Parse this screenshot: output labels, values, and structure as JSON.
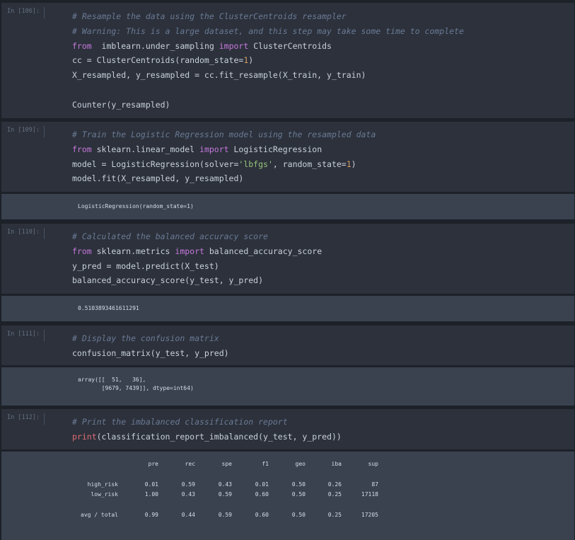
{
  "cells": [
    {
      "prompt": "In [106]:",
      "lines": [
        [
          [
            "cm",
            "# Resample the data using the ClusterCentroids resampler"
          ]
        ],
        [
          [
            "cm",
            "# Warning: This is a large dataset, and this step may take some time to complete"
          ]
        ],
        [
          [
            "kw",
            "from"
          ],
          [
            "",
            "  imblearn.under_sampling "
          ],
          [
            "kw",
            "import"
          ],
          [
            "",
            " ClusterCentroids"
          ]
        ],
        [
          [
            "",
            "cc = ClusterCentroids(random_state="
          ],
          [
            "num",
            "1"
          ],
          [
            "",
            ")"
          ]
        ],
        [
          [
            "",
            "X_resampled, y_resampled = cc.fit_resample(X_train, y_train)"
          ]
        ],
        [
          [
            "",
            ""
          ]
        ],
        [
          [
            "",
            "Counter(y_resampled)"
          ]
        ]
      ]
    },
    {
      "prompt": "In [109]:",
      "lines": [
        [
          [
            "cm",
            "# Train the Logistic Regression model using the resampled data"
          ]
        ],
        [
          [
            "kw",
            "from"
          ],
          [
            "",
            " sklearn.linear_model "
          ],
          [
            "kw",
            "import"
          ],
          [
            "",
            " LogisticRegression"
          ]
        ],
        [
          [
            "",
            "model = LogisticRegression(solver="
          ],
          [
            "str",
            "'lbfgs'"
          ],
          [
            "",
            ", random_state="
          ],
          [
            "num",
            "1"
          ],
          [
            "",
            ")"
          ]
        ],
        [
          [
            "",
            "model.fit(X_resampled, y_resampled)"
          ]
        ]
      ],
      "output": "LogisticRegression(random_state=1)"
    },
    {
      "prompt": "In [110]:",
      "lines": [
        [
          [
            "cm",
            "# Calculated the balanced accuracy score"
          ]
        ],
        [
          [
            "kw",
            "from"
          ],
          [
            "",
            " sklearn.metrics "
          ],
          [
            "kw",
            "import"
          ],
          [
            "",
            " balanced_accuracy_score"
          ]
        ],
        [
          [
            "",
            "y_pred = model.predict(X_test)"
          ]
        ],
        [
          [
            "",
            "balanced_accuracy_score(y_test, y_pred)"
          ]
        ]
      ],
      "output": "0.5103893461611291"
    },
    {
      "prompt": "In [111]:",
      "lines": [
        [
          [
            "cm",
            "# Display the confusion matrix"
          ]
        ],
        [
          [
            "",
            "confusion_matrix(y_test, y_pred)"
          ]
        ]
      ],
      "output": "array([[  51,   36],\n       [9679, 7439]], dtype=int64)"
    },
    {
      "prompt": "In [112]:",
      "lines": [
        [
          [
            "cm",
            "# Print the imbalanced classification report"
          ]
        ],
        [
          [
            "fn",
            "print"
          ],
          [
            "",
            "(classification_report_imbalanced(y_test, y_pred))"
          ]
        ]
      ]
    }
  ],
  "report": {
    "headers": [
      "pre",
      "rec",
      "spe",
      "f1",
      "geo",
      "iba",
      "sup"
    ],
    "rows": [
      {
        "label": "high_risk",
        "values": [
          "0.01",
          "0.59",
          "0.43",
          "0.01",
          "0.50",
          "0.26",
          "87"
        ]
      },
      {
        "label": "low_risk",
        "values": [
          "1.00",
          "0.43",
          "0.59",
          "0.60",
          "0.50",
          "0.25",
          "17118"
        ]
      },
      {
        "label": "avg / total",
        "values": [
          "0.99",
          "0.44",
          "0.59",
          "0.60",
          "0.50",
          "0.25",
          "17205"
        ]
      }
    ]
  }
}
